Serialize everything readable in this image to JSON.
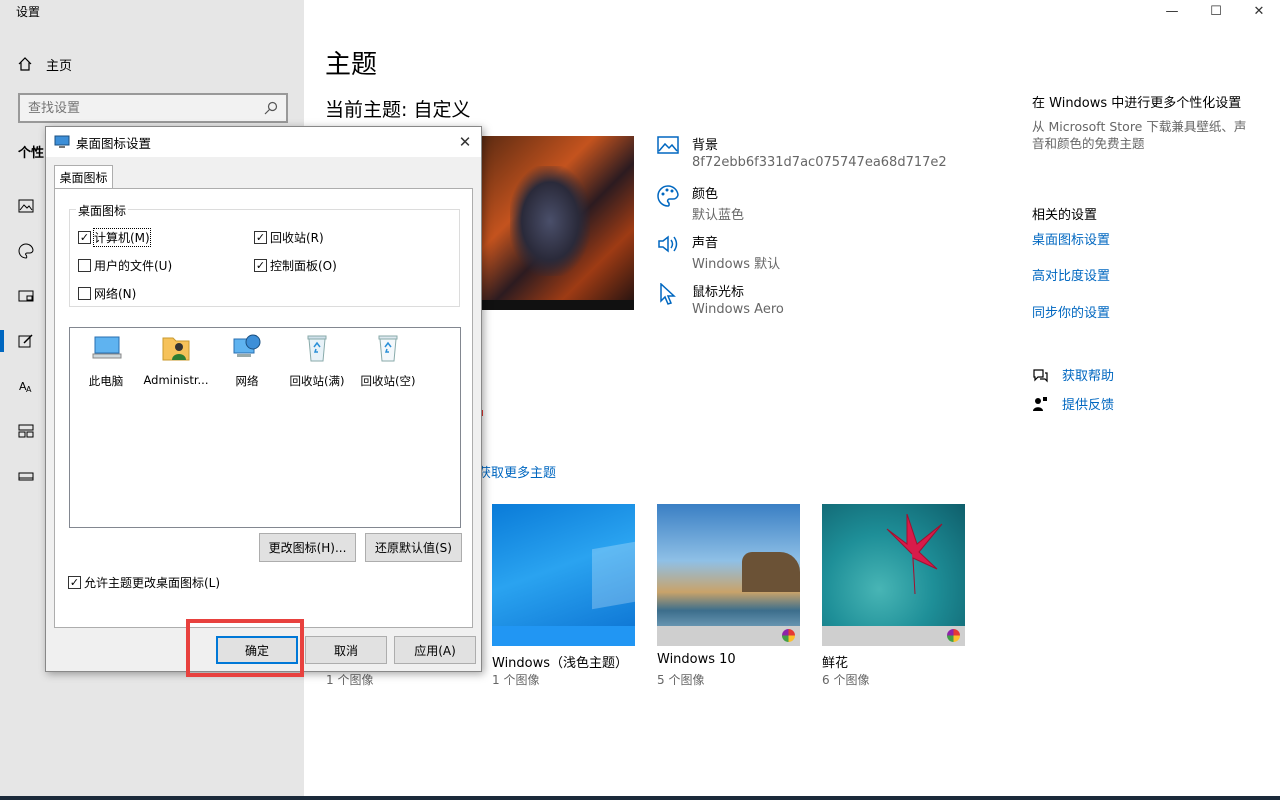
{
  "window": {
    "app_title": "设置",
    "min": "—",
    "max": "☐",
    "close": "✕"
  },
  "sidebar": {
    "home_label": "主页",
    "search_placeholder": "查找设置",
    "section_heading": "个性",
    "nav_icons": [
      "image-icon",
      "palette-icon",
      "display-icon",
      "start-icon",
      "font-icon",
      "taskbar-icon",
      "tablet-icon"
    ]
  },
  "main": {
    "title": "主题",
    "current_theme": "当前主题: 自定义",
    "properties": [
      {
        "label": "背景",
        "value": "8f72ebb6f331d7ac075747ea68d717e2"
      },
      {
        "label": "颜色",
        "value": "默认蓝色"
      },
      {
        "label": "声音",
        "value": "Windows 默认"
      },
      {
        "label": "鼠标光标",
        "value": "Windows Aero"
      }
    ],
    "get_more_link": "获取更多主题",
    "themes": [
      {
        "name": "",
        "count": "1 个图像"
      },
      {
        "name": "Windows（浅色主题）",
        "count": "1 个图像"
      },
      {
        "name": "Windows 10",
        "count": "5 个图像"
      },
      {
        "name": "鲜花",
        "count": "6 个图像"
      }
    ]
  },
  "right_panel": {
    "more_heading": "在 Windows 中进行更多个性化设置",
    "more_desc": "从 Microsoft Store 下载兼具壁纸、声音和颜色的免费主题",
    "related_heading": "相关的设置",
    "related_links": [
      "桌面图标设置",
      "高对比度设置",
      "同步你的设置"
    ],
    "help_label": "获取帮助",
    "feedback_label": "提供反馈"
  },
  "dialog": {
    "title": "桌面图标设置",
    "tab": "桌面图标",
    "group_label": "桌面图标",
    "checkboxes": [
      {
        "label": "计算机(M)",
        "checked": true
      },
      {
        "label": "回收站(R)",
        "checked": true
      },
      {
        "label": "用户的文件(U)",
        "checked": false
      },
      {
        "label": "控制面板(O)",
        "checked": true
      },
      {
        "label": "网络(N)",
        "checked": false
      }
    ],
    "icons": [
      "此电脑",
      "Administr...",
      "网络",
      "回收站(满)",
      "回收站(空)"
    ],
    "change_icon_btn": "更改图标(H)...",
    "restore_default_btn": "还原默认值(S)",
    "allow_themes_label": "允许主题更改桌面图标(L)",
    "ok": "确定",
    "cancel": "取消",
    "apply": "应用(A)"
  },
  "colors": {
    "accent": "#0067c0",
    "highlight_box": "#e8413e"
  }
}
